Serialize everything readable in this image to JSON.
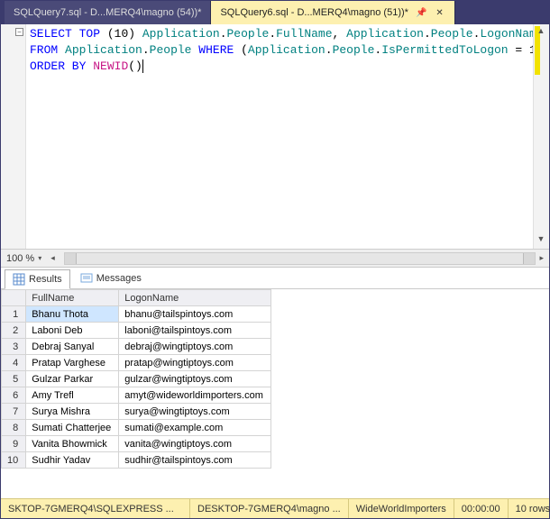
{
  "tabs": [
    {
      "label": "SQLQuery7.sql - D...MERQ4\\magno (54))*"
    },
    {
      "label": "SQLQuery6.sql - D...MERQ4\\magno (51))*"
    }
  ],
  "active_tab_index": 1,
  "sql": {
    "l1_kw1": "SELECT",
    "l1_kw2": "TOP",
    "l1_paren_open": " (",
    "l1_num": "10",
    "l1_paren_close": ") ",
    "l1_obj1": "Application",
    "l1_dot1": ".",
    "l1_obj2": "People",
    "l1_dot2": ".",
    "l1_obj3": "FullName",
    "l1_comma": ", ",
    "l1_obj4": "Application",
    "l1_dot3": ".",
    "l1_obj5": "People",
    "l1_dot4": ".",
    "l1_obj6": "LogonName",
    "l2_kw1": "FROM",
    "l2_sp1": " ",
    "l2_obj1": "Application",
    "l2_dot1": ".",
    "l2_obj2": "People",
    "l2_sp2": " ",
    "l2_kw2": "WHERE",
    "l2_sp3": " (",
    "l2_obj3": "Application",
    "l2_dot2": ".",
    "l2_obj4": "People",
    "l2_dot3": ".",
    "l2_obj5": "IsPermittedToLogon",
    "l2_eq": " = ",
    "l2_num": "1",
    "l2_close": ")",
    "l3_kw1": "ORDER BY",
    "l3_sp": " ",
    "l3_func": "NEWID",
    "l3_parens": "()"
  },
  "zoom": "100 %",
  "result_tabs": {
    "results": "Results",
    "messages": "Messages"
  },
  "columns": {
    "fullname": "FullName",
    "logonname": "LogonName"
  },
  "rows": [
    {
      "n": "1",
      "fullname": "Bhanu Thota",
      "logon": "bhanu@tailspintoys.com"
    },
    {
      "n": "2",
      "fullname": "Laboni Deb",
      "logon": "laboni@tailspintoys.com"
    },
    {
      "n": "3",
      "fullname": "Debraj Sanyal",
      "logon": "debraj@wingtiptoys.com"
    },
    {
      "n": "4",
      "fullname": "Pratap Varghese",
      "logon": "pratap@wingtiptoys.com"
    },
    {
      "n": "5",
      "fullname": "Gulzar Parkar",
      "logon": "gulzar@wingtiptoys.com"
    },
    {
      "n": "6",
      "fullname": "Amy Trefl",
      "logon": "amyt@wideworldimporters.com"
    },
    {
      "n": "7",
      "fullname": "Surya Mishra",
      "logon": "surya@wingtiptoys.com"
    },
    {
      "n": "8",
      "fullname": "Sumati Chatterjee",
      "logon": "sumati@example.com"
    },
    {
      "n": "9",
      "fullname": "Vanita Bhowmick",
      "logon": "vanita@wingtiptoys.com"
    },
    {
      "n": "10",
      "fullname": "Sudhir Yadav",
      "logon": "sudhir@tailspintoys.com"
    }
  ],
  "status": {
    "server": "SKTOP-7GMERQ4\\SQLEXPRESS ...",
    "user": "DESKTOP-7GMERQ4\\magno ...",
    "db": "WideWorldImporters",
    "elapsed": "00:00:00",
    "rows": "10 rows"
  }
}
